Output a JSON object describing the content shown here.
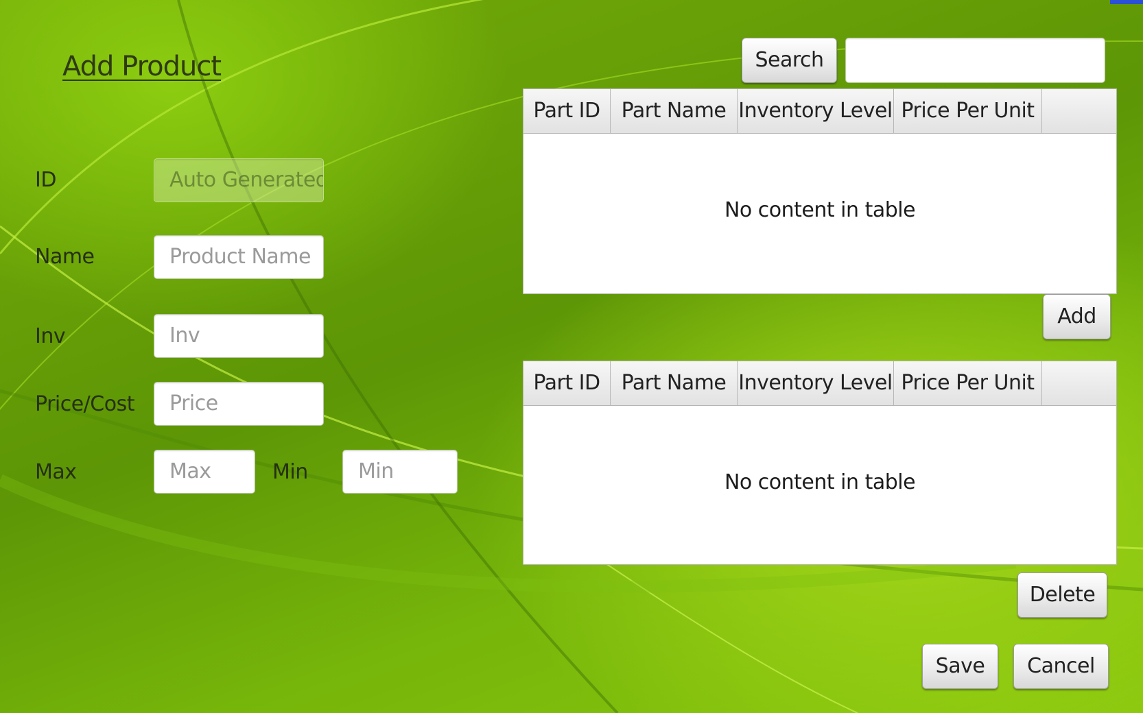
{
  "form": {
    "title": "Add Product",
    "fields": {
      "id": {
        "label": "ID",
        "placeholder": "Auto Generated"
      },
      "name": {
        "label": "Name",
        "placeholder": "Product Name"
      },
      "inv": {
        "label": "Inv",
        "placeholder": "Inv"
      },
      "price": {
        "label": "Price/Cost",
        "placeholder": "Price"
      },
      "max": {
        "label": "Max",
        "placeholder": "Max"
      },
      "min": {
        "label": "Min",
        "placeholder": "Min"
      }
    }
  },
  "search": {
    "button_label": "Search",
    "value": ""
  },
  "parts_table": {
    "columns": [
      "Part ID",
      "Part Name",
      "Inventory Level",
      "Price Per Unit",
      ""
    ],
    "rows": [],
    "empty_text": "No content in table"
  },
  "associated_table": {
    "columns": [
      "Part ID",
      "Part Name",
      "Inventory Level",
      "Price Per Unit",
      ""
    ],
    "rows": [],
    "empty_text": "No content in table"
  },
  "buttons": {
    "add": "Add",
    "delete": "Delete",
    "save": "Save",
    "cancel": "Cancel"
  },
  "colors": {
    "background_primary": "#6ca607",
    "background_highlight": "#a6d81a",
    "swoosh": "#b8ec3a"
  }
}
